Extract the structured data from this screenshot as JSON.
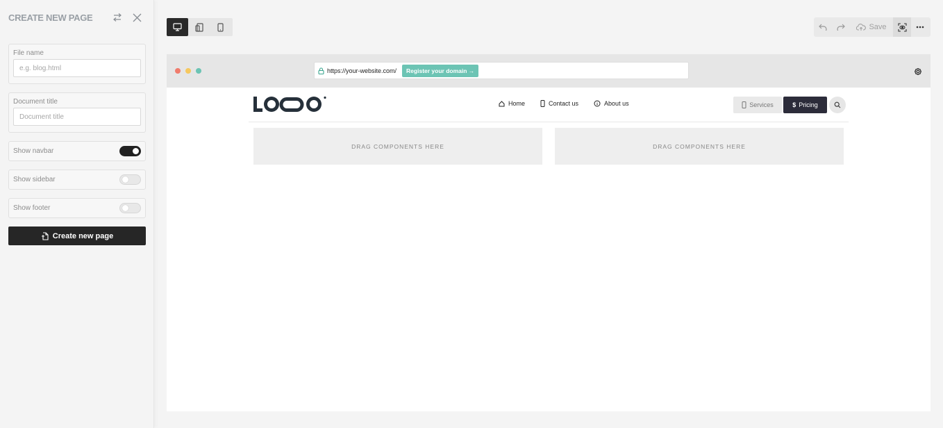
{
  "sidebar": {
    "title": "CREATE NEW PAGE",
    "swap_icon": "swap-arrows-icon",
    "close_icon": "close-icon",
    "file_name": {
      "label": "File name",
      "placeholder": "e.g. blog.html",
      "value": ""
    },
    "document_title": {
      "label": "Document title",
      "placeholder": "Document title",
      "value": ""
    },
    "toggles": [
      {
        "label": "Show navbar",
        "on": true
      },
      {
        "label": "Show sidebar",
        "on": false
      },
      {
        "label": "Show footer",
        "on": false
      }
    ],
    "create_button": "Create new page"
  },
  "toolbar": {
    "devices": [
      "desktop-icon",
      "tablet-icon",
      "mobile-icon"
    ],
    "active_device": "desktop",
    "save_label": "Save"
  },
  "browser": {
    "url": "https://your-website.com/",
    "register_label": "Register your domain →",
    "dot_colors": [
      "#f07c6c",
      "#f6c85f",
      "#6cc4b4"
    ]
  },
  "site": {
    "logo_text": "LOQO",
    "nav": [
      {
        "label": "Home",
        "icon": "home-icon"
      },
      {
        "label": "Contact us",
        "icon": "phone-icon"
      },
      {
        "label": "About us",
        "icon": "info-icon"
      }
    ],
    "services_label": "Services",
    "pricing_label": "Pricing",
    "dropzones": [
      "DRAG COMPONENTS HERE",
      "DRAG COMPONENTS HERE"
    ]
  }
}
